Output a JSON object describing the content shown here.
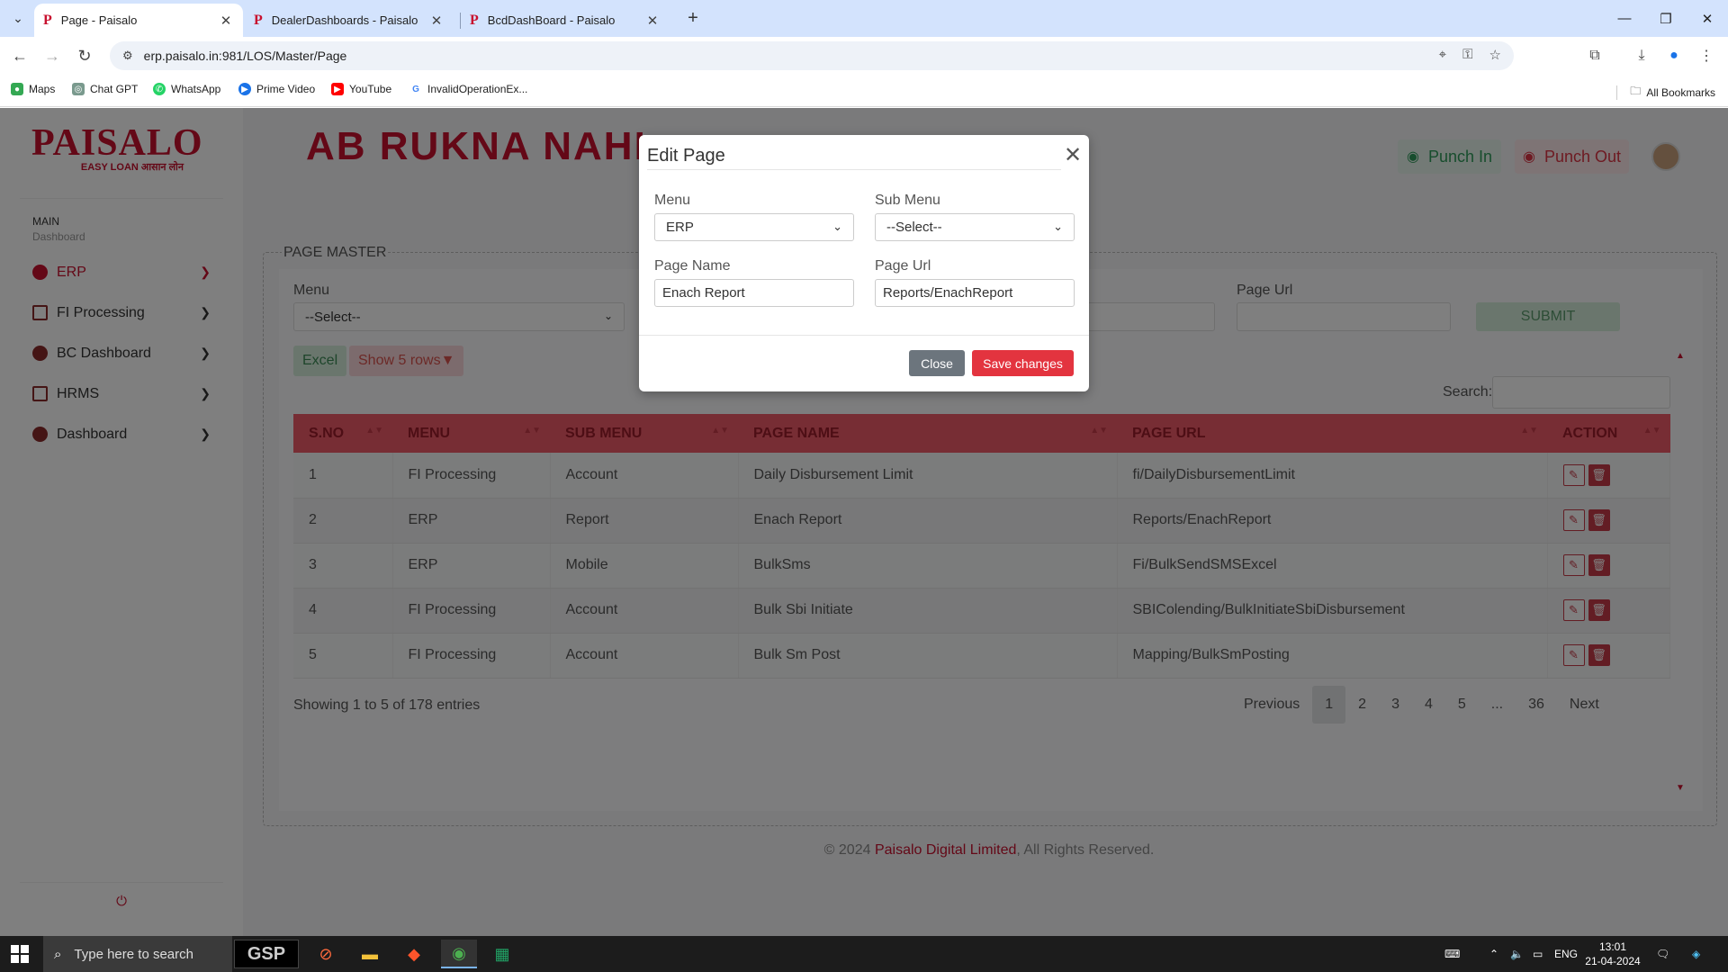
{
  "browser": {
    "tabs": [
      {
        "title": "Page - Paisalo",
        "active": true
      },
      {
        "title": "DealerDashboards - Paisalo",
        "active": false
      },
      {
        "title": "BcdDashBoard - Paisalo",
        "active": false
      }
    ],
    "url": "erp.paisalo.in:981/LOS/Master/Page",
    "bookmarks": [
      "Maps",
      "Chat GPT",
      "WhatsApp",
      "Prime Video",
      "YouTube",
      "InvalidOperationEx..."
    ],
    "all_bookmarks": "All Bookmarks"
  },
  "logo": {
    "name": "PAISALO",
    "tagline": "EASY LOAN आसान लोन"
  },
  "sidebar": {
    "section": "MAIN",
    "subsection": "Dashboard",
    "items": [
      {
        "label": "ERP",
        "active": true
      },
      {
        "label": "FI Processing",
        "active": false
      },
      {
        "label": "BC Dashboard",
        "active": false
      },
      {
        "label": "HRMS",
        "active": false
      },
      {
        "label": "Dashboard",
        "active": false
      }
    ]
  },
  "header": {
    "marquee": "AB RUKNA NAHI",
    "punch_in": "Punch In",
    "punch_out": "Punch Out"
  },
  "page_master": {
    "legend": "PAGE MASTER",
    "menu_label": "Menu",
    "menu_value": "--Select--",
    "page_url_label": "Page Url",
    "submit": "SUBMIT",
    "excel": "Excel",
    "show_rows": "Show 5 rows▼",
    "search_label": "Search:"
  },
  "table": {
    "columns": [
      "S.NO",
      "MENU",
      "SUB MENU",
      "PAGE NAME",
      "PAGE URL",
      "ACTION"
    ],
    "rows": [
      [
        "1",
        "FI Processing",
        "Account",
        "Daily Disbursement Limit",
        "fi/DailyDisbursementLimit"
      ],
      [
        "2",
        "ERP",
        "Report",
        "Enach Report",
        "Reports/EnachReport"
      ],
      [
        "3",
        "ERP",
        "Mobile",
        "BulkSms",
        "Fi/BulkSendSMSExcel"
      ],
      [
        "4",
        "FI Processing",
        "Account",
        "Bulk Sbi Initiate",
        "SBIColending/BulkInitiateSbiDisbursement"
      ],
      [
        "5",
        "FI Processing",
        "Account",
        "Bulk Sm Post",
        "Mapping/BulkSmPosting"
      ]
    ],
    "entries_info": "Showing 1 to 5 of 178 entries",
    "pagination": {
      "previous": "Previous",
      "pages": [
        "1",
        "2",
        "3",
        "4",
        "5",
        "...",
        "36"
      ],
      "current": "1",
      "next": "Next"
    }
  },
  "footer": {
    "prefix": "© 2024 ",
    "brand": "Paisalo Digital Limited",
    "suffix": ", All Rights Reserved."
  },
  "modal": {
    "title": "Edit Page",
    "menu_label": "Menu",
    "menu_value": "ERP",
    "submenu_label": "Sub Menu",
    "submenu_value": "--Select--",
    "page_name_label": "Page Name",
    "page_name_value": "Enach Report",
    "page_url_label": "Page Url",
    "page_url_value": "Reports/EnachReport",
    "close": "Close",
    "save": "Save changes"
  },
  "taskbar": {
    "search_placeholder": "Type here to search",
    "gsp": "GSP",
    "language": "ENG",
    "time": "13:01",
    "date": "21-04-2024"
  },
  "colors": {
    "brand": "#c8102e",
    "table_header": "#ef5a69",
    "save": "#e3343f",
    "close": "#6c757d"
  }
}
